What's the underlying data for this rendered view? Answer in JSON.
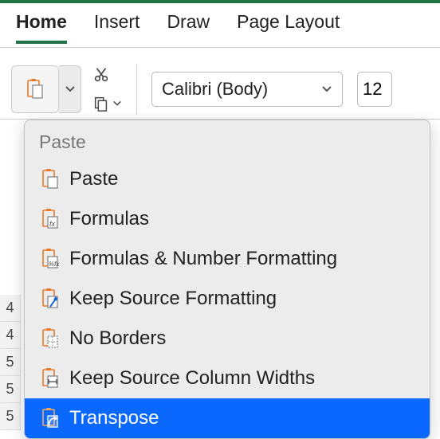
{
  "tabs": {
    "home": "Home",
    "insert": "Insert",
    "draw": "Draw",
    "page_layout": "Page Layout"
  },
  "font": {
    "name": "Calibri (Body)",
    "size": "12"
  },
  "menu": {
    "header": "Paste",
    "items": [
      {
        "label": "Paste"
      },
      {
        "label": "Formulas"
      },
      {
        "label": "Formulas & Number Formatting"
      },
      {
        "label": "Keep Source Formatting"
      },
      {
        "label": "No Borders"
      },
      {
        "label": "Keep Source Column Widths"
      },
      {
        "label": "Transpose"
      }
    ]
  },
  "rows": [
    "4",
    "4",
    "5",
    "5",
    "5"
  ]
}
